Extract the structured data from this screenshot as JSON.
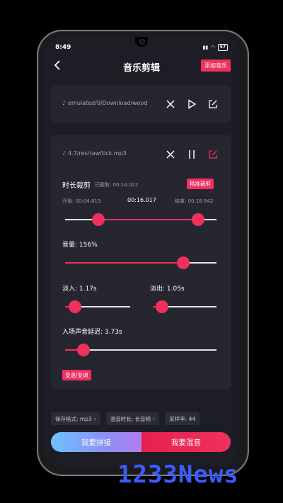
{
  "status": {
    "time": "8:49",
    "battery": "57"
  },
  "appbar": {
    "title": "音乐剪辑",
    "add_button": "添加音乐"
  },
  "track1": {
    "path": "emulated/0/Download/wood"
  },
  "track2": {
    "path": "4.7/res/raw/tick.mp3"
  },
  "trim": {
    "title": "时长裁剪",
    "cut_label": "已截取: 00:14.022",
    "precise_button": "精准裁剪",
    "start_label": "开始: 00:04.819",
    "current": "00:16.017",
    "end_label": "结束: 00:18.842",
    "start_fraction": 0.22,
    "end_fraction": 0.88
  },
  "volume": {
    "label": "音量: 156%",
    "fraction": 0.78
  },
  "fade_in": {
    "label": "淡入: 1.17s",
    "fraction": 0.15
  },
  "fade_out": {
    "label": "淡出: 1.05s",
    "fraction": 0.14
  },
  "delay": {
    "label": "入场声音延迟: 3.73s",
    "fraction": 0.12
  },
  "speed_button": "变速/变调",
  "bottom": {
    "format": "保存格式: mp3",
    "mix_duration": "混音时长: 长音频",
    "sample_rate": "采样率: 44"
  },
  "actions": {
    "concat": "我要拼接",
    "mix": "我要混音"
  },
  "watermark": "1233News",
  "colors": {
    "accent": "#f0305e",
    "background": "#1d1e25",
    "card": "#25262f"
  }
}
